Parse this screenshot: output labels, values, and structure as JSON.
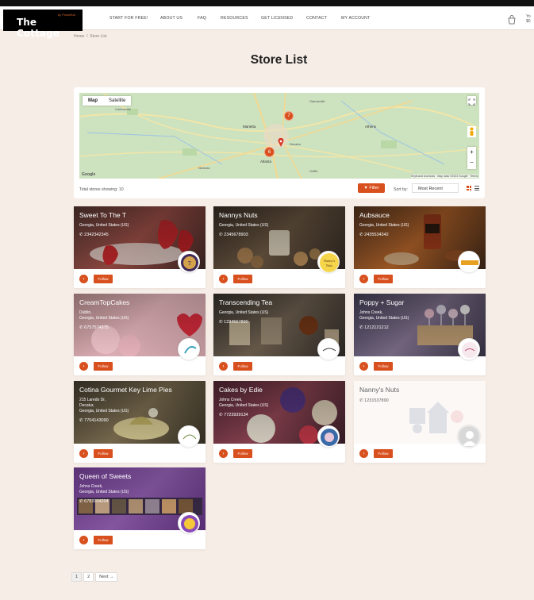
{
  "site": {
    "logo_text": "The Cottage",
    "logo_tagline": "by FoodHub",
    "nav_right_text": "Yo $0",
    "menu": [
      "START FOR FREE!",
      "ABOUT US",
      "FAQ",
      "RESOURCES",
      "GET LICENSED",
      "CONTACT",
      "MY ACCOUNT"
    ]
  },
  "breadcrumb": {
    "home": "Home",
    "sep": "/",
    "current": "Store List"
  },
  "page_title": "Store List",
  "map": {
    "map_tab": "Map",
    "satellite_tab": "Satellite",
    "zoom_in": "+",
    "zoom_out": "−",
    "google": "Google",
    "footer": "Keyboard shortcuts · Map data ©2023 Google · Terms",
    "cluster_labels": [
      "7",
      "6"
    ],
    "city_labels": [
      "Cartersville",
      "Marietta",
      "Atlanta",
      "Athens",
      "Decatur",
      "Newnan",
      "Griffin",
      "Gainesville"
    ]
  },
  "toolbar": {
    "showing": "Total stores showing: 10",
    "filter_label": "▼ Filter",
    "sort_label": "Sort by:",
    "sort_value": "Most Recent"
  },
  "stores": [
    {
      "name": "Sweet To The T",
      "address": [
        "Georgia, United States (US)"
      ],
      "phone": "2342342345",
      "theme": "strawberry"
    },
    {
      "name": "Nannys Nuts",
      "address": [
        "Georgia, United States (US)"
      ],
      "phone": "2345678903",
      "theme": "nuts"
    },
    {
      "name": "Aubsauce",
      "address": [
        "Georgia, United States (US)"
      ],
      "phone": "2435534342",
      "theme": "sauce"
    },
    {
      "name": "CreamTopCakes",
      "address": [
        "Dublin,",
        "Georgia, United States (US)"
      ],
      "phone": "6757574375",
      "theme": "cake"
    },
    {
      "name": "Transcending Tea",
      "address": [
        "Georgia, United States (US)"
      ],
      "phone": "1234567890",
      "theme": "tea"
    },
    {
      "name": "Poppy + Sugar",
      "address": [
        "Johns Creek,",
        "Georgia, United States (US)"
      ],
      "phone": "1212121212",
      "theme": "pops"
    },
    {
      "name": "Cotina Gourmet Key Lime Pies",
      "address": [
        "215 Laredo Dr,",
        "Decatur,",
        "Georgia, United States (US)"
      ],
      "phone": "7704143090",
      "theme": "pie"
    },
    {
      "name": "Cakes by Edie",
      "address": [
        "Johns Creek,",
        "Georgia, United States (US)"
      ],
      "phone": "7723939134",
      "theme": "cakes"
    },
    {
      "name": "Nanny's Nuts",
      "address": [],
      "phone": "1231537890",
      "theme": "blank"
    },
    {
      "name": "Queen of Sweets",
      "address": [
        "Johns Creek,",
        "Georgia, United States (US)"
      ],
      "phone": "6783104204",
      "theme": "queen"
    }
  ],
  "card_buttons": {
    "go": "›",
    "follow": "Follow"
  },
  "pagination": [
    "1",
    "2",
    "Next →"
  ],
  "colors": {
    "accent": "#d8501e",
    "background": "#f6ede6"
  }
}
